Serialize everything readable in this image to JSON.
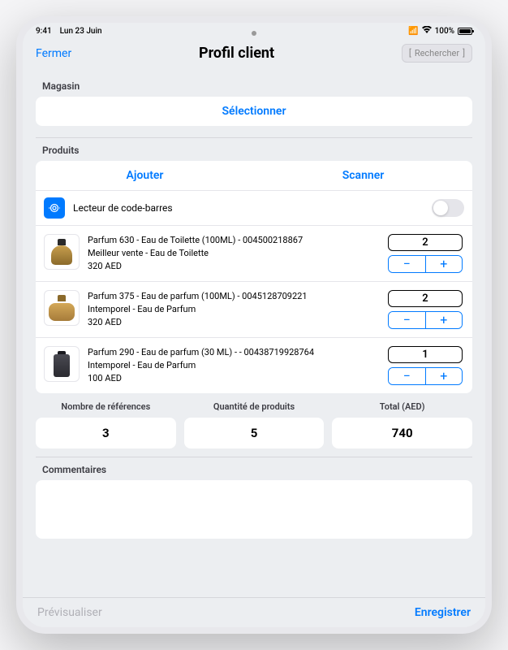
{
  "status": {
    "time": "9:41",
    "date": "Lun 23 Juin",
    "battery": "100%"
  },
  "header": {
    "close": "Fermer",
    "title": "Profil client",
    "search": "Rechercher"
  },
  "sections": {
    "store": "Magasin",
    "select": "Sélectionner",
    "products": "Produits",
    "comments": "Commentaires"
  },
  "tabs": {
    "add": "Ajouter",
    "scan": "Scanner"
  },
  "barcode": {
    "label": "Lecteur de code-barres"
  },
  "products": [
    {
      "line1": "Parfum 630 - Eau de Toilette (100ML) - 004500218867",
      "line2": "Meilleur vente  - Eau de Toilette",
      "line3": "320 AED",
      "qty": "2"
    },
    {
      "line1": "Parfum 375 - Eau de parfum (100ML) - 0045128709221",
      "line2": "Intemporel - Eau de Parfum",
      "line3": "320 AED",
      "qty": "2"
    },
    {
      "line1": "Parfum 290 - Eau de parfum (30 ML) - - 00438719928764",
      "line2": "Intemporel  - Eau de Parfum",
      "line3": "100 AED",
      "qty": "1"
    }
  ],
  "summary": {
    "refs_label": "Nombre de références",
    "refs": "3",
    "qty_label": "Quantité de produits",
    "qty": "5",
    "total_label": "Total (AED)",
    "total": "740"
  },
  "footer": {
    "preview": "Prévisualiser",
    "save": "Enregistrer"
  }
}
